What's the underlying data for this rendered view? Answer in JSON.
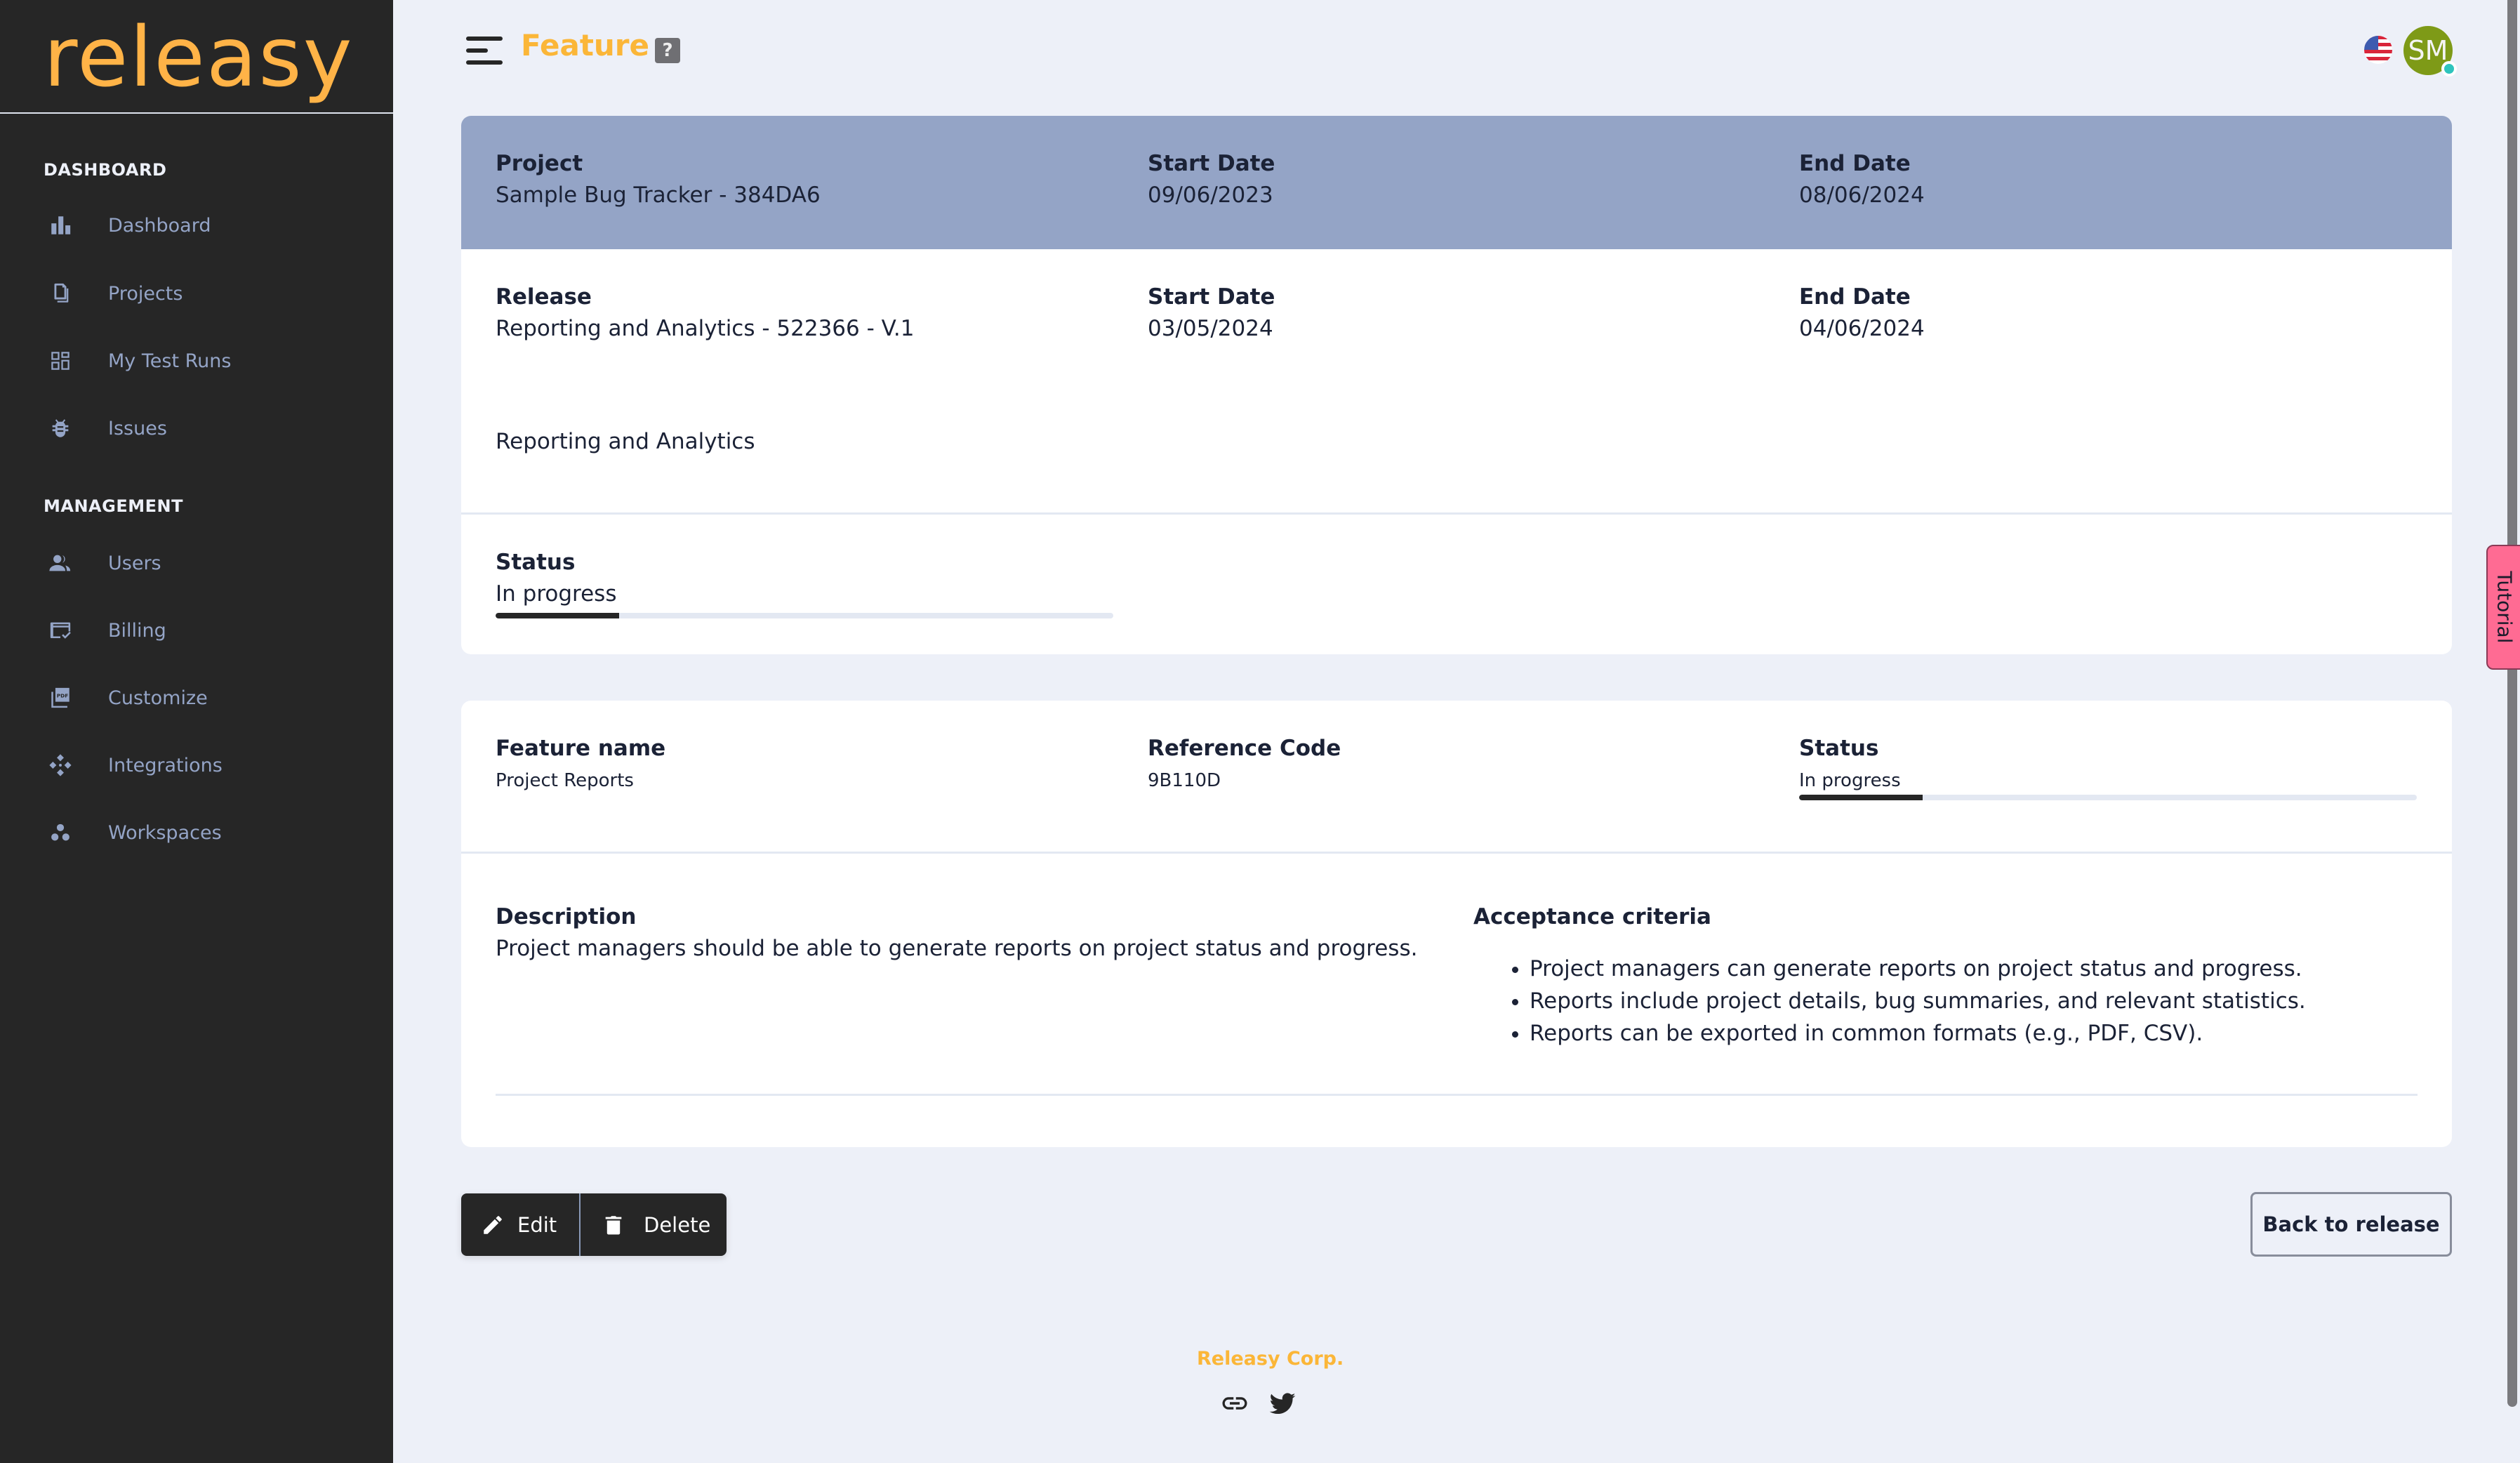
{
  "app": {
    "logo_text": "releasy",
    "brand_color": "#ffb347",
    "accent_color": "#fbb638"
  },
  "sidebar": {
    "sections": [
      {
        "label": "DASHBOARD",
        "items": [
          {
            "label": "Dashboard",
            "icon": "bar-chart-icon"
          },
          {
            "label": "Projects",
            "icon": "documents-icon"
          },
          {
            "label": "My Test Runs",
            "icon": "grid-icon"
          },
          {
            "label": "Issues",
            "icon": "bug-icon"
          }
        ]
      },
      {
        "label": "MANAGEMENT",
        "items": [
          {
            "label": "Users",
            "icon": "users-icon"
          },
          {
            "label": "Billing",
            "icon": "billing-card-icon"
          },
          {
            "label": "Customize",
            "icon": "pdf-icon"
          },
          {
            "label": "Integrations",
            "icon": "integrations-icon"
          },
          {
            "label": "Workspaces",
            "icon": "workspaces-icon"
          }
        ]
      }
    ]
  },
  "header": {
    "title": "Feature",
    "help_label": "?",
    "language": "en-US",
    "avatar_initials": "SM",
    "avatar_color": "#7e9a17",
    "online_status_color": "#2ec4bd"
  },
  "tutorial_tab": {
    "label": "Tutorial"
  },
  "project": {
    "project_label": "Project",
    "project_value": "Sample Bug Tracker - 384DA6",
    "start_label": "Start Date",
    "start_value": "09/06/2023",
    "end_label": "End Date",
    "end_value": "08/06/2024"
  },
  "release": {
    "release_label": "Release",
    "release_value": "Reporting and Analytics - 522366 - V.1",
    "start_label": "Start Date",
    "start_value": "03/05/2024",
    "end_label": "End Date",
    "end_value": "04/06/2024",
    "description": "Reporting and Analytics",
    "status_label": "Status",
    "status_value": "In progress",
    "status_progress_percent": 20
  },
  "feature": {
    "name_label": "Feature name",
    "name_value": "Project Reports",
    "ref_label": "Reference Code",
    "ref_value": "9B110D",
    "status_label": "Status",
    "status_value": "In progress",
    "status_progress_percent": 20,
    "description_label": "Description",
    "description_value": "Project managers should be able to generate reports on project status and progress.",
    "acceptance_label": "Acceptance criteria",
    "acceptance_items": [
      "Project managers can generate reports on project status and progress.",
      "Reports include project details, bug summaries, and relevant statistics.",
      "Reports can be exported in common formats (e.g., PDF, CSV)."
    ]
  },
  "actions": {
    "edit_label": "Edit",
    "delete_label": "Delete",
    "back_label": "Back to release"
  },
  "footer": {
    "company": "Releasy Corp.",
    "icons": [
      "link-icon",
      "twitter-icon"
    ]
  }
}
